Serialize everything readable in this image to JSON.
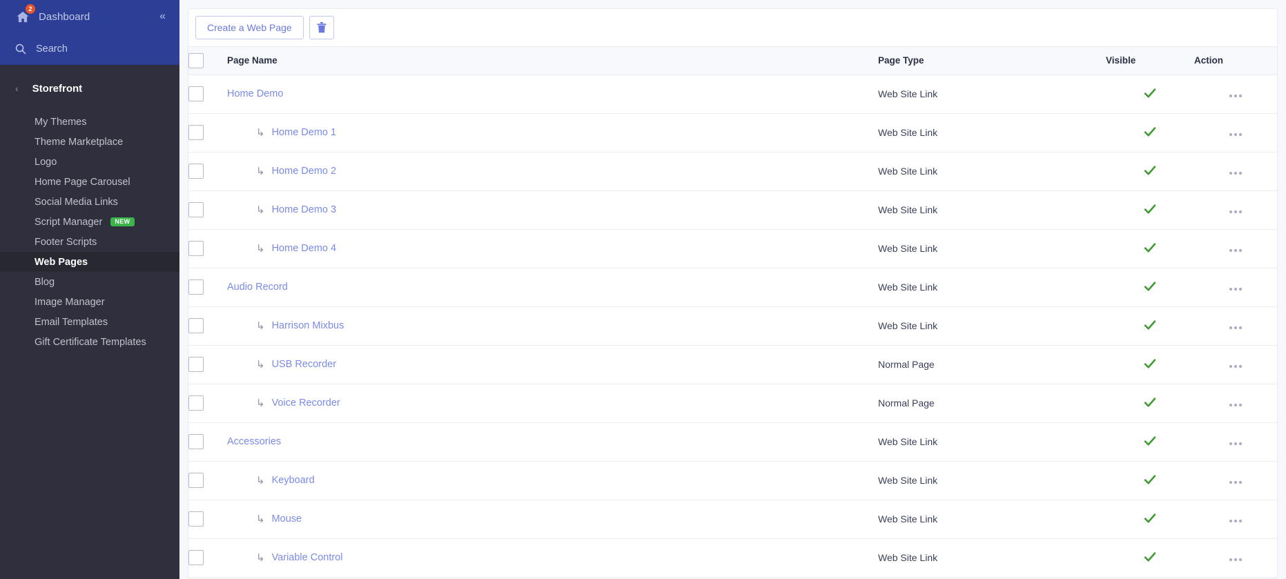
{
  "sidebar": {
    "dashboard_label": "Dashboard",
    "dashboard_badge": "2",
    "collapse_icon": "«",
    "search_label": "Search",
    "section_title": "Storefront",
    "back_chevron": "‹",
    "items": [
      {
        "label": "My Themes",
        "active": false,
        "badge": ""
      },
      {
        "label": "Theme Marketplace",
        "active": false,
        "badge": ""
      },
      {
        "label": "Logo",
        "active": false,
        "badge": ""
      },
      {
        "label": "Home Page Carousel",
        "active": false,
        "badge": ""
      },
      {
        "label": "Social Media Links",
        "active": false,
        "badge": ""
      },
      {
        "label": "Script Manager",
        "active": false,
        "badge": "NEW"
      },
      {
        "label": "Footer Scripts",
        "active": false,
        "badge": ""
      },
      {
        "label": "Web Pages",
        "active": true,
        "badge": ""
      },
      {
        "label": "Blog",
        "active": false,
        "badge": ""
      },
      {
        "label": "Image Manager",
        "active": false,
        "badge": ""
      },
      {
        "label": "Email Templates",
        "active": false,
        "badge": ""
      },
      {
        "label": "Gift Certificate Templates",
        "active": false,
        "badge": ""
      }
    ]
  },
  "toolbar": {
    "create_label": "Create a Web Page",
    "trash_icon": "trash-icon"
  },
  "table": {
    "headers": {
      "page_name": "Page Name",
      "page_type": "Page Type",
      "visible": "Visible",
      "action": "Action"
    },
    "sub_arrow": "↳",
    "rows": [
      {
        "name": "Home Demo",
        "child": false,
        "type": "Web Site Link",
        "visible": true,
        "group_start": true
      },
      {
        "name": "Home Demo 1",
        "child": true,
        "type": "Web Site Link",
        "visible": true,
        "group_start": false
      },
      {
        "name": "Home Demo 2",
        "child": true,
        "type": "Web Site Link",
        "visible": true,
        "group_start": false
      },
      {
        "name": "Home Demo 3",
        "child": true,
        "type": "Web Site Link",
        "visible": true,
        "group_start": false
      },
      {
        "name": "Home Demo 4",
        "child": true,
        "type": "Web Site Link",
        "visible": true,
        "group_start": false
      },
      {
        "name": "Audio Record",
        "child": false,
        "type": "Web Site Link",
        "visible": true,
        "group_start": true
      },
      {
        "name": "Harrison Mixbus",
        "child": true,
        "type": "Web Site Link",
        "visible": true,
        "group_start": false
      },
      {
        "name": "USB Recorder",
        "child": true,
        "type": "Normal Page",
        "visible": true,
        "group_start": false
      },
      {
        "name": "Voice Recorder",
        "child": true,
        "type": "Normal Page",
        "visible": true,
        "group_start": false
      },
      {
        "name": "Accessories",
        "child": false,
        "type": "Web Site Link",
        "visible": true,
        "group_start": true
      },
      {
        "name": "Keyboard",
        "child": true,
        "type": "Web Site Link",
        "visible": true,
        "group_start": false
      },
      {
        "name": "Mouse",
        "child": true,
        "type": "Web Site Link",
        "visible": true,
        "group_start": false
      },
      {
        "name": "Variable Control",
        "child": true,
        "type": "Web Site Link",
        "visible": true,
        "group_start": false
      }
    ]
  },
  "colors": {
    "sidebar_top": "#2c3e96",
    "sidebar_bg": "#2f2f3d",
    "link": "#7b8ae8",
    "accent": "#6c7ae0",
    "badge": "#e8552a",
    "new_badge": "#3bb54a",
    "check": "#3f9c35"
  }
}
